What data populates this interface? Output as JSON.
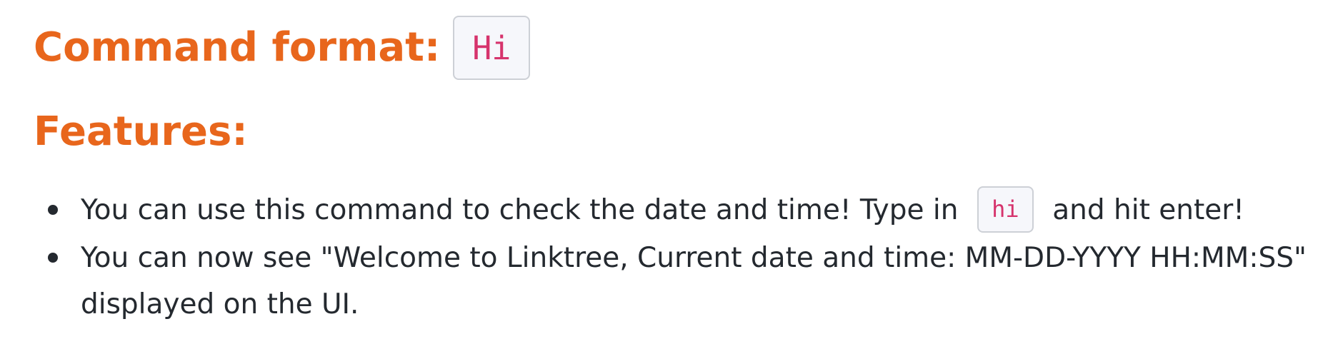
{
  "command_section": {
    "heading": "Command format:",
    "command": "Hi"
  },
  "features_section": {
    "heading": "Features:",
    "items": [
      {
        "text_before": "You can use this command to check the date and time! Type in",
        "code": "hi",
        "text_after": "and hit enter!"
      },
      {
        "text": "You can now see \"Welcome to Linktree, Current date and time: MM-DD-YYYY HH:MM:SS\" displayed on the UI."
      }
    ]
  },
  "colors": {
    "heading": "#e8661c",
    "code_text": "#d6336c",
    "code_background": "#f6f7fb",
    "code_border": "#cdd0d6",
    "body_text": "#24292f"
  }
}
